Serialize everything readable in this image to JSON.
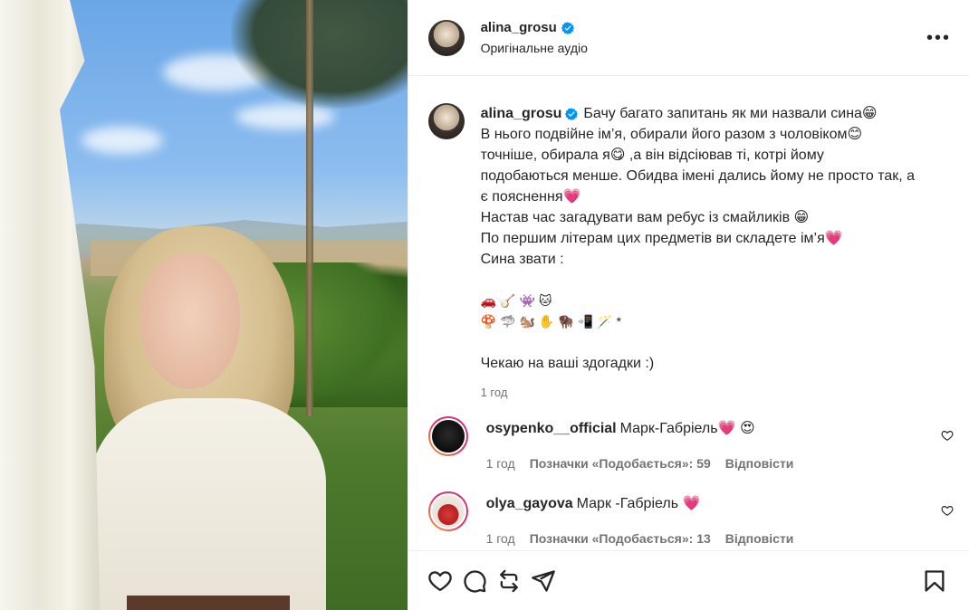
{
  "post": {
    "author": {
      "username": "alina_grosu",
      "verified": true,
      "audio_label": "Оригінальне аудіо"
    },
    "caption": {
      "username": "alina_grosu",
      "lines": [
        "Бачу багато запитань як ми назвали сина😁",
        "В нього подвійне ім’я, обирали його разом з чоловіком😊",
        "точніше, обирала я😋 ,а він відсіював ті, котрі йому",
        "подобаються менше. Обидва імені дались йому не просто так, а",
        "є пояснення💗",
        "Настав час загадувати вам ребус із смайликів 😁",
        "По першим літерам цих предметів ви складете ім’я💗",
        "Сина звати :",
        "",
        "🚗🪕👾🐱",
        "🍄🦈🐿️✋🦬📲🪄*",
        "",
        "Чекаю на ваші здогадки :)"
      ],
      "time": "1 год"
    },
    "comments": [
      {
        "username": "osypenko__official",
        "text": "Марк-Габріель💗 😍",
        "time": "1 год",
        "likes_label": "Позначки «Подобається»: 59",
        "reply_label": "Відповісти",
        "avatar_icon": "osypenko-avatar"
      },
      {
        "username": "olya_gayova",
        "text": "Марк -Габріель 💗",
        "time": "1 год",
        "likes_label": "Позначки «Подобається»: 13",
        "reply_label": "Відповісти",
        "avatar_icon": "olya-avatar"
      }
    ],
    "actions": {
      "icons": [
        "heart-icon",
        "comment-icon",
        "repost-icon",
        "share-icon",
        "bookmark-icon"
      ],
      "more_icon": "more-icon"
    },
    "colors": {
      "verified": "#0095f6",
      "text_primary": "#262626",
      "text_secondary": "#737373",
      "border": "#efefef"
    }
  }
}
